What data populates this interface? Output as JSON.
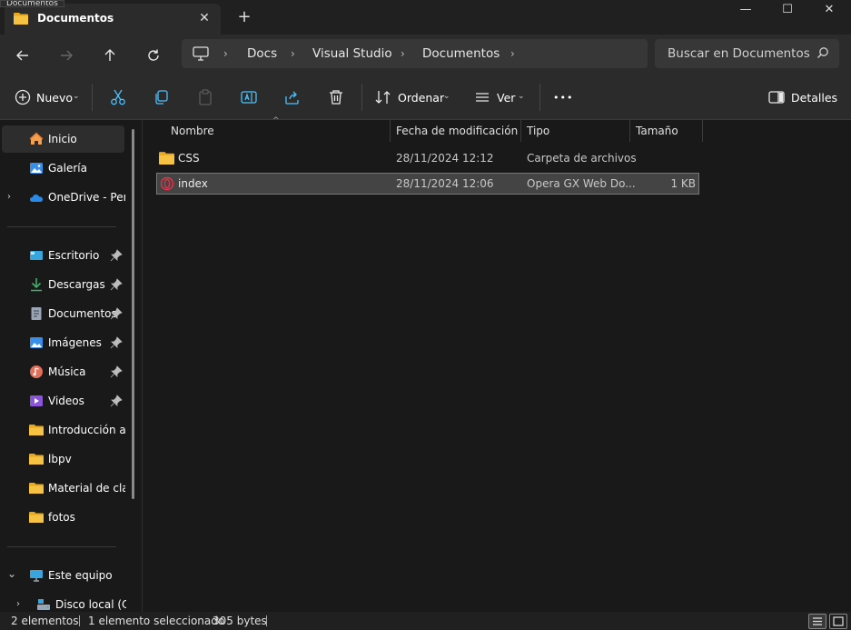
{
  "window": {
    "tooltip": "Documentos",
    "tab_title": "Documentos",
    "tab_close": "✕",
    "new_tab": "+",
    "minimize": "—",
    "maximize": "☐",
    "close": "✕"
  },
  "address": {
    "crumbs": [
      "Docs",
      "Visual Studio",
      "Documentos"
    ],
    "separator": "›",
    "search_placeholder": "Buscar en Documentos"
  },
  "toolbar": {
    "new_label": "Nuevo",
    "sort_label": "Ordenar",
    "view_label": "Ver",
    "more_label": "•••",
    "details_label": "Detalles",
    "chevron": "⌄"
  },
  "sidebar": {
    "items": [
      {
        "label": "Inicio",
        "icon": "home-icon"
      },
      {
        "label": "Galería",
        "icon": "gallery-icon"
      },
      {
        "label": "OneDrive - Personal",
        "icon": "onedrive-icon"
      },
      {
        "label": "Escritorio",
        "icon": "desktop-icon"
      },
      {
        "label": "Descargas",
        "icon": "download-icon"
      },
      {
        "label": "Documentos",
        "icon": "documents-icon"
      },
      {
        "label": "Imágenes",
        "icon": "pictures-icon"
      },
      {
        "label": "Música",
        "icon": "music-icon"
      },
      {
        "label": "Videos",
        "icon": "videos-icon"
      },
      {
        "label": "Introducción a S",
        "icon": "folder-icon"
      },
      {
        "label": "lbpv",
        "icon": "folder-icon"
      },
      {
        "label": "Material de clase",
        "icon": "folder-icon"
      },
      {
        "label": "fotos",
        "icon": "folder-icon"
      },
      {
        "label": "Este equipo",
        "icon": "computer-icon"
      },
      {
        "label": "Disco local (C:)",
        "icon": "drive-icon"
      }
    ],
    "expand_chevron": "›",
    "collapse_chevron": "⌄"
  },
  "columns": {
    "name": "Nombre",
    "modified": "Fecha de modificación",
    "type": "Tipo",
    "size": "Tamaño",
    "sort_indicator": "^"
  },
  "files": [
    {
      "name": "CSS",
      "modified": "28/11/2024 12:12",
      "type": "Carpeta de archivos",
      "size": "",
      "icon": "folder-icon"
    },
    {
      "name": "index",
      "modified": "28/11/2024 12:06",
      "type": "Opera GX Web Do...",
      "size": "1 KB",
      "icon": "opera-gx-icon"
    }
  ],
  "status": {
    "count": "2 elementos",
    "selected": "1 elemento seleccionado",
    "size": "305 bytes"
  },
  "colors": {
    "accent_blue": "#4cc2ff",
    "folder_yellow": "#f5c244",
    "opera_red": "#e5334b"
  }
}
